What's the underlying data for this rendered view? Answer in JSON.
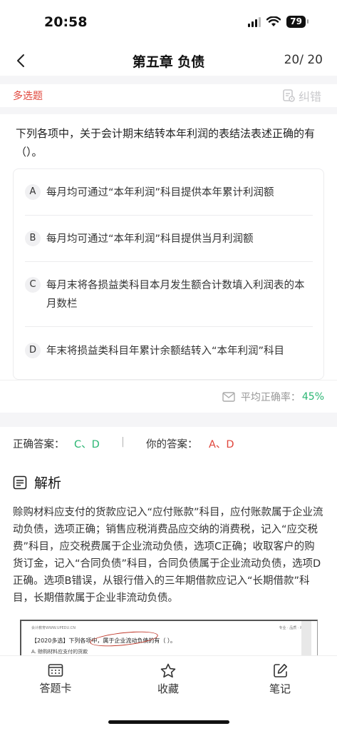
{
  "status": {
    "time": "20:58",
    "battery": "79"
  },
  "nav": {
    "title": "第五章 负债",
    "progress": "20/ 20"
  },
  "question": {
    "type": "多选题",
    "error_label": "纠错",
    "stem": "下列各项中，关于会计期末结转本年利润的表结法表述正确的有（）。",
    "options": [
      {
        "letter": "A",
        "text": "每月均可通过“本年利润”科目提供本年累计利润额"
      },
      {
        "letter": "B",
        "text": "每月均可通过“本年利润”科目提供当月利润额"
      },
      {
        "letter": "C",
        "text": "每月末将各损益类科目本月发生额合计数填入利润表的本月数栏"
      },
      {
        "letter": "D",
        "text": "年末将损益类科目年累计余额结转入“本年利润”科目"
      }
    ]
  },
  "rate": {
    "label": "平均正确率：",
    "value": "45%"
  },
  "answers": {
    "correct_label": "正确答案：",
    "correct_value": "C、D",
    "separator": "|",
    "yours_label": "你的答案：",
    "yours_value": "A、D"
  },
  "analysis": {
    "title": "解析",
    "text": "赊购材料应支付的货款应记入“应付账款”科目，应付账款属于企业流动负债，选项正确；销售应税消费品应交纳的消费税，记入“应交税费”科目，应交税费属于企业流动负债，选项C正确；收取客户的购货订金，记入“合同负债”科目，合同负债属于企业流动负债，选项D正确。选项B错误，从银行借入的三年期借款应记入“长期借款”科目，长期借款属于企业非流动负债。"
  },
  "scan_image": {
    "header_left": "会计教育WWW.UPEDU.CN",
    "header_right": "专业 · 品质 · 增值",
    "question": "【2020多选】下列各项中，属于企业流动负债的有（ ）。",
    "option_a": "A. 赊购材料应支付的货款"
  },
  "tabs": [
    {
      "label": "答题卡",
      "icon": "answer-card-icon"
    },
    {
      "label": "收藏",
      "icon": "star-icon"
    },
    {
      "label": "笔记",
      "icon": "note-edit-icon"
    }
  ],
  "colors": {
    "accent_red": "#e0463c",
    "accent_green": "#2bb673"
  }
}
